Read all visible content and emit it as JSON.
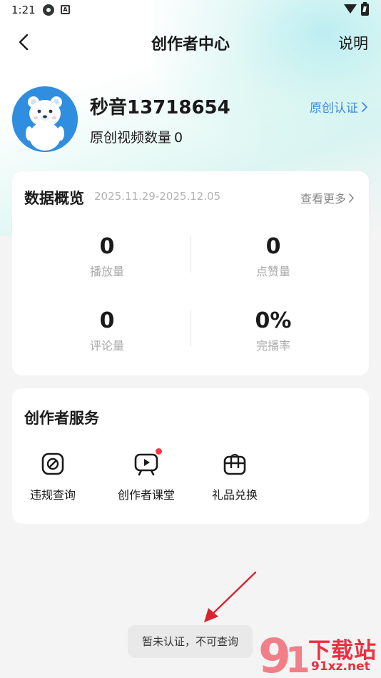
{
  "status_bar": {
    "time": "1:21"
  },
  "header": {
    "title": "创作者中心",
    "help": "说明"
  },
  "profile": {
    "username": "秒音13718654",
    "video_count_label": "原创视频数量",
    "video_count": "0",
    "certify_label": "原创认证"
  },
  "overview": {
    "title": "数据概览",
    "date_range": "2025.11.29-2025.12.05",
    "more_label": "查看更多",
    "stats": [
      {
        "value": "0",
        "label": "播放量"
      },
      {
        "value": "0",
        "label": "点赞量"
      },
      {
        "value": "0",
        "label": "评论量"
      },
      {
        "value": "0%",
        "label": "完播率"
      }
    ]
  },
  "services": {
    "title": "创作者服务",
    "items": [
      {
        "label": "违规查询",
        "icon": "prohibited-icon"
      },
      {
        "label": "创作者课堂",
        "icon": "video-class-icon"
      },
      {
        "label": "礼品兑换",
        "icon": "gift-box-icon"
      }
    ]
  },
  "toast": {
    "message": "暂未认证，不可查询"
  },
  "watermark": {
    "brand": "下载站",
    "url": "91xz.net"
  },
  "colors": {
    "accent": "#3d8ae8",
    "red_dot": "#f43d4a",
    "watermark": "#e8313f"
  }
}
